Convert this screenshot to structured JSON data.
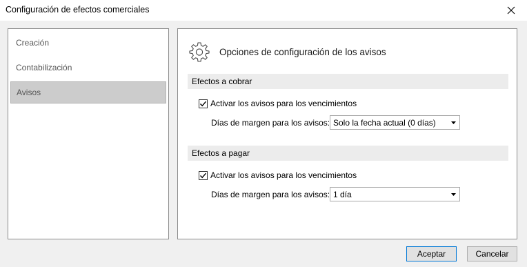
{
  "window": {
    "title": "Configuración de efectos comerciales",
    "close_icon": "close-icon"
  },
  "nav": {
    "items": [
      {
        "label": "Creación",
        "selected": false
      },
      {
        "label": "Contabilización",
        "selected": false
      },
      {
        "label": "Avisos",
        "selected": true
      }
    ]
  },
  "content": {
    "header_icon": "gear-icon",
    "header_title": "Opciones de configuración de los avisos",
    "sections": [
      {
        "title": "Efectos a cobrar",
        "checkbox_label": "Activar los avisos para los vencimientos",
        "checked": true,
        "margin_label": "Días de margen para los avisos:",
        "margin_value": "Solo la fecha actual (0 días)"
      },
      {
        "title": "Efectos a pagar",
        "checkbox_label": "Activar los avisos para los vencimientos",
        "checked": true,
        "margin_label": "Días de margen para los avisos:",
        "margin_value": "1 día"
      }
    ]
  },
  "buttons": {
    "accept": "Aceptar",
    "cancel": "Cancelar"
  },
  "colors": {
    "selected_nav_bg": "#cccccc",
    "section_bar_bg": "#ececec",
    "default_button_border": "#0078d7"
  }
}
